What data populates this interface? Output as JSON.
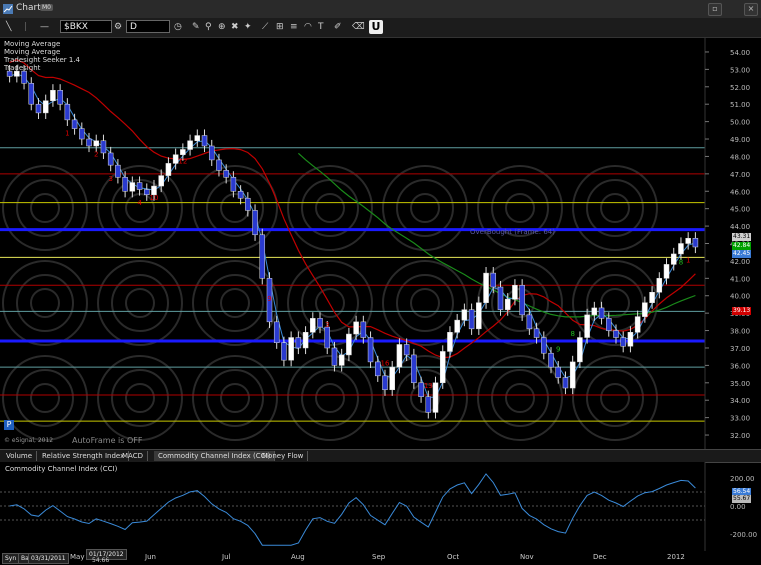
{
  "window": {
    "title": "Chart",
    "badge": "M0"
  },
  "toolbar": {
    "symbol": "$BKX",
    "interval": "D"
  },
  "legend": {
    "lines": [
      "Moving Average",
      "Moving Average",
      "Tradesight Seeker 1.4",
      "Tradesight"
    ]
  },
  "overlay_label": "OverBought (Frame: 64)",
  "autoframe": "AutoFrame is OFF",
  "copyright": "© eSignal, 2012",
  "p_button": "P",
  "price_axis": {
    "ticks": [
      "54.00",
      "53.00",
      "52.00",
      "51.00",
      "50.00",
      "49.00",
      "48.00",
      "47.00",
      "46.00",
      "45.00",
      "44.00",
      "43.00",
      "42.00",
      "41.00",
      "40.00",
      "39.00",
      "38.00",
      "37.00",
      "36.00",
      "35.00",
      "34.00",
      "33.00",
      "32.00"
    ],
    "labels": [
      {
        "text": "43.31",
        "color": "#cfcfcf"
      },
      {
        "text": "42.84",
        "color": "#00a000"
      },
      {
        "text": "42.45",
        "color": "#3a7bd5"
      },
      {
        "text": "39.13",
        "color": "#d00000"
      }
    ]
  },
  "indicator_tabs": [
    "Volume",
    "Relative Strength Index",
    "MACD",
    "Commodity Channel Index (CCI)",
    "Money Flow"
  ],
  "cci": {
    "title": "Commodity Channel Index (CCI)",
    "ticks": [
      "200.00",
      "0.00",
      "-200.00"
    ],
    "labels": [
      {
        "text": "56.54",
        "color": "#3a7bd5"
      },
      {
        "text": "55.67",
        "color": "#bbbbbb"
      }
    ]
  },
  "datebar": {
    "months": [
      "Jun",
      "Jul",
      "Aug",
      "Sep",
      "Oct",
      "Nov",
      "Dec",
      "2012"
    ],
    "start_date": "03/31/2011",
    "end_date": "01/17/2012",
    "left_tags": [
      "Syn",
      "Bar"
    ],
    "extra": "May",
    "extra2": "54.66"
  },
  "chart_data": {
    "type": "candlestick",
    "symbol": "$BKX",
    "interval": "D",
    "ylim": [
      31.6,
      54.4
    ],
    "horizontal_levels": [
      {
        "value": 48.5,
        "color": "#5f9ea0"
      },
      {
        "value": 47.0,
        "color": "#b00000"
      },
      {
        "value": 45.35,
        "color": "#c8c800"
      },
      {
        "value": 43.8,
        "color": "#1a1aff"
      },
      {
        "value": 42.2,
        "color": "#e8e85a"
      },
      {
        "value": 40.6,
        "color": "#b00000"
      },
      {
        "value": 39.1,
        "color": "#5f9ea0"
      },
      {
        "value": 37.4,
        "color": "#1a1aff"
      },
      {
        "value": 35.9,
        "color": "#5f9ea0"
      },
      {
        "value": 34.3,
        "color": "#b00000"
      },
      {
        "value": 32.8,
        "color": "#c8c800"
      }
    ],
    "close_approx": [
      52.6,
      52.9,
      52.2,
      51.0,
      50.5,
      51.2,
      51.8,
      51.0,
      50.1,
      49.6,
      49.0,
      48.6,
      48.9,
      48.2,
      47.5,
      46.8,
      46.0,
      46.5,
      46.1,
      45.8,
      46.3,
      46.9,
      47.6,
      48.1,
      48.4,
      48.9,
      49.2,
      48.6,
      47.8,
      47.2,
      46.8,
      46.0,
      45.6,
      44.9,
      43.5,
      41.0,
      38.5,
      37.3,
      36.3,
      37.6,
      37.0,
      37.9,
      38.7,
      38.2,
      37.0,
      36.0,
      36.6,
      37.8,
      38.5,
      37.6,
      36.2,
      35.4,
      34.6,
      35.9,
      37.2,
      36.6,
      35.0,
      34.2,
      33.3,
      35.0,
      36.8,
      37.9,
      38.6,
      39.2,
      38.1,
      39.6,
      41.3,
      40.5,
      39.2,
      39.8,
      40.6,
      38.9,
      38.1,
      37.6,
      36.7,
      35.9,
      35.3,
      34.7,
      36.2,
      37.6,
      38.9,
      39.3,
      38.7,
      38.0,
      37.6,
      37.1,
      37.9,
      38.8,
      39.6,
      40.2,
      41.0,
      41.8,
      42.4,
      43.0,
      43.3,
      42.8
    ]
  }
}
